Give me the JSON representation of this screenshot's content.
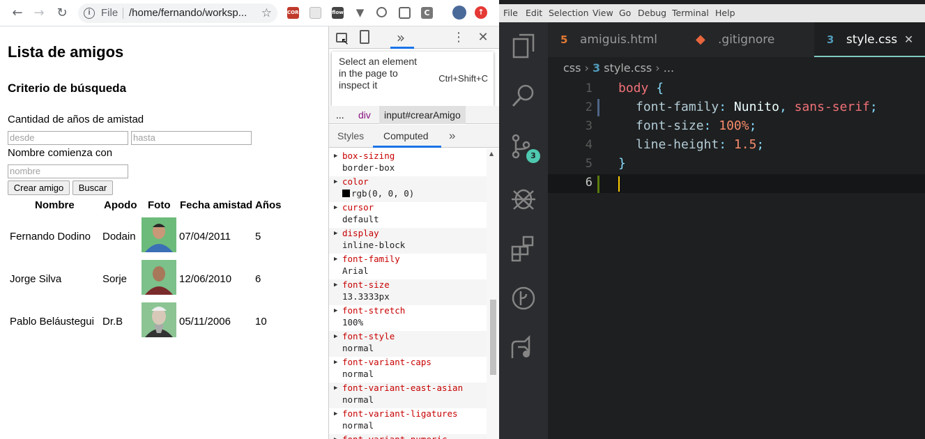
{
  "browser": {
    "scheme": "File",
    "path": "/home/fernando/worksp...",
    "extensions": [
      "CORS",
      "flow"
    ]
  },
  "page": {
    "title": "Lista de amigos",
    "subtitle": "Criterio de búsqueda",
    "years_label": "Cantidad de años de amistad",
    "from_placeholder": "desde",
    "to_placeholder": "hasta",
    "name_label": "Nombre comienza con",
    "name_placeholder": "nombre",
    "create_button": "Crear amigo",
    "search_button": "Buscar",
    "columns": [
      "Nombre",
      "Apodo",
      "Foto",
      "Fecha amistad",
      "Años"
    ],
    "rows": [
      {
        "name": "Fernando Dodino",
        "nick": "Dodain",
        "date": "07/04/2011",
        "years": "5"
      },
      {
        "name": "Jorge Silva",
        "nick": "Sorje",
        "date": "12/06/2010",
        "years": "6"
      },
      {
        "name": "Pablo Beláustegui",
        "nick": "Dr.B",
        "date": "05/11/2006",
        "years": "10"
      }
    ]
  },
  "devtools": {
    "tooltip_text": "Select an element in the page to inspect it",
    "tooltip_shortcut": "Ctrl+Shift+C",
    "crumbs": [
      "...",
      "div",
      "input#crearAmigo"
    ],
    "tabs": [
      "Styles",
      "Computed"
    ],
    "more": "»",
    "properties": [
      {
        "name": "box-sizing",
        "value": "border-box"
      },
      {
        "name": "color",
        "value": "rgb(0, 0, 0)"
      },
      {
        "name": "cursor",
        "value": "default"
      },
      {
        "name": "display",
        "value": "inline-block"
      },
      {
        "name": "font-family",
        "value": "Arial"
      },
      {
        "name": "font-size",
        "value": "13.3333px"
      },
      {
        "name": "font-stretch",
        "value": "100%"
      },
      {
        "name": "font-style",
        "value": "normal"
      },
      {
        "name": "font-variant-caps",
        "value": "normal"
      },
      {
        "name": "font-variant-east-asian",
        "value": "normal"
      },
      {
        "name": "font-variant-ligatures",
        "value": "normal"
      },
      {
        "name": "font-variant-numeric",
        "value": ""
      }
    ]
  },
  "vscode": {
    "menu": [
      "File",
      "Edit",
      "Selection",
      "View",
      "Go",
      "Debug",
      "Terminal",
      "Help"
    ],
    "tabs": [
      {
        "label": "amiguis.html",
        "icon": "html5-icon",
        "active": false
      },
      {
        "label": ".gitignore",
        "icon": "git-icon",
        "active": false
      },
      {
        "label": "style.css",
        "icon": "css3-icon",
        "active": true
      }
    ],
    "breadcrumb": {
      "folder": "css",
      "file": "style.css",
      "more": "..."
    },
    "scm_badge": "3",
    "line_numbers": [
      "1",
      "2",
      "3",
      "4",
      "5",
      "6"
    ],
    "code": {
      "selector": "body",
      "open": "{",
      "close": "}",
      "decls": [
        {
          "prop": "font-family",
          "value": "Nunito",
          "sep": ", ",
          "value2": "sans-serif"
        },
        {
          "prop": "font-size",
          "value": "100%"
        },
        {
          "prop": "line-height",
          "value": "1.5"
        }
      ]
    },
    "colors": {
      "keyword": "#f07178",
      "property": "#c3e88d",
      "brace": "#89ddff",
      "number": "#f78c6c"
    }
  }
}
